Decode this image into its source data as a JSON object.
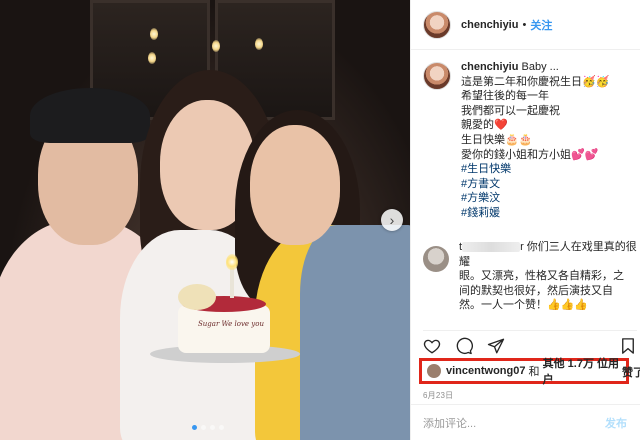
{
  "post": {
    "username": "chenchiyiu",
    "follow_label": "关注",
    "header_separator": "•"
  },
  "caption": {
    "username": "chenchiyiu",
    "first_line": "Baby ...",
    "lines": [
      "這是第二年和你慶祝生日🥳🥳",
      "希望往後的每一年",
      "我們都可以一起慶祝",
      "親愛的❤️",
      "生日快樂🎂🎂",
      "愛你的錢小姐和方小姐💕💕"
    ],
    "hashtags": [
      "#生日快樂",
      "#方書文",
      "#方樂汶",
      "#錢莉媛"
    ]
  },
  "comment": {
    "username_tail": "r",
    "text_lines": [
      "你们三人在戏里真的很耀",
      "眼。又漂亮，性格又各自精彩，之",
      "间的默契也很好，然后演技又自",
      "然。一人一个赞！👍👍👍"
    ],
    "username_prefix": "t"
  },
  "likes": {
    "first_user": "vincentwong07",
    "joiner": "和",
    "others_label": "其他 1.7万 位用户",
    "cut_text": "赞了"
  },
  "date": "6月23日",
  "add_comment": {
    "placeholder": "添加评论...",
    "post_label": "发布"
  },
  "photo": {
    "cake_text": "Sugar We love you"
  },
  "carousel": {
    "dot_count": 4,
    "active_index": 0
  },
  "icons": {
    "like": "heart-icon",
    "comment": "comment-icon",
    "share": "share-icon",
    "save": "bookmark-icon",
    "next": "chevron-right-icon"
  },
  "colors": {
    "link": "#3897f0",
    "highlight_box": "#e0261a",
    "hashtag": "#00376b"
  }
}
